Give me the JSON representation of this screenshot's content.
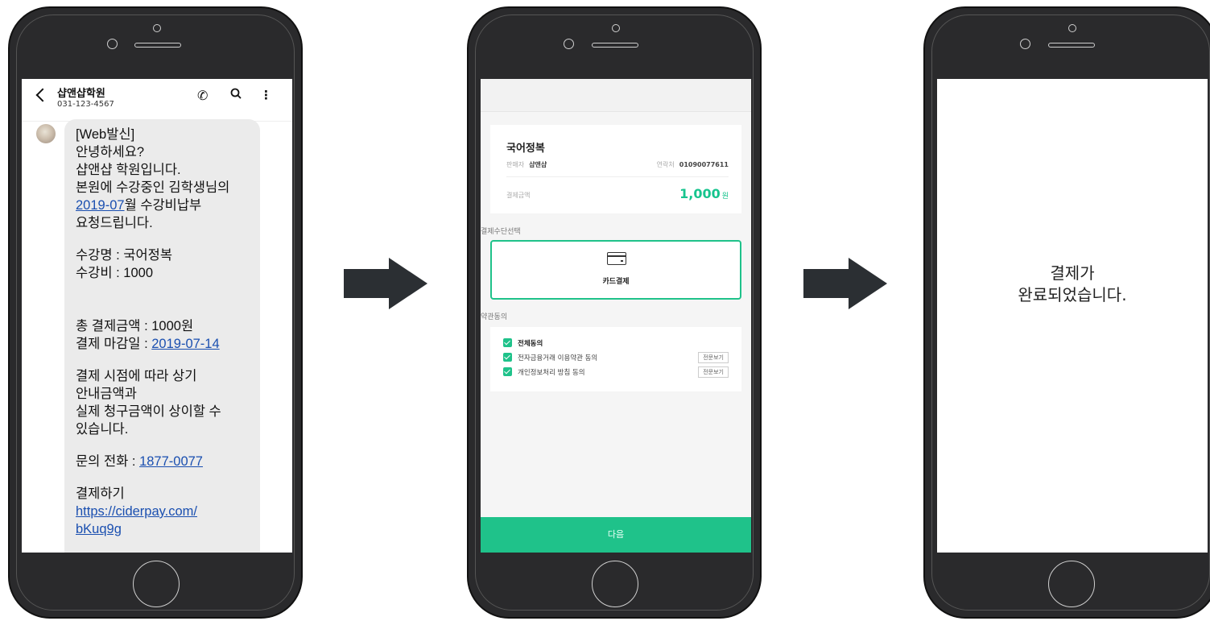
{
  "sms": {
    "sender_name": "샵앤샵학원",
    "sender_phone": "031-123-4567",
    "icons": [
      "back-chevron",
      "call-icon",
      "search-icon",
      "more-vert-icon"
    ],
    "lines": {
      "l1": "[Web발신]",
      "l2": "안녕하세요?",
      "l3": "샵앤샵 학원입니다.",
      "l4": "본원에 수강중인 김학생님의",
      "l5_link": "2019-07",
      "l5_rest": "월 수강비납부",
      "l6": "요청드립니다.",
      "l7": "수강명 : 국어정복",
      "l8": "수강비 : 1000",
      "l9": "총 결제금액 : 1000원",
      "l10_label": "결제 마감일 : ",
      "l10_link": "2019-07-14",
      "l11": "결제 시점에 따라 상기",
      "l12": "안내금액과",
      "l13": "실제 청구금액이 상이할 수",
      "l14": "있습니다.",
      "l15_label": "문의 전화 : ",
      "l15_link": "1877-0077",
      "l16": "결제하기",
      "l17_link": "https://ciderpay.com/",
      "l18_link": "bKuq9g"
    }
  },
  "payment": {
    "product_name": "국어정복",
    "seller_label": "판매자",
    "seller_value": "샵앤샵",
    "contact_label": "연락처",
    "contact_value": "01090077611",
    "amount_label": "결제금액",
    "amount_value": "1,000",
    "amount_unit": "원",
    "method_section": "결제수단선택",
    "method_option": "카드결제",
    "terms_section": "약관동의",
    "terms": {
      "all": "전체동의",
      "t1": "전자금융거래 이용약관 동의",
      "t2": "개인정보처리 방침 동의",
      "view": "전문보기"
    },
    "next_button": "다음",
    "accent_color": "#1fc28a"
  },
  "complete": {
    "line1": "결제가",
    "line2": "완료되었습니다."
  }
}
